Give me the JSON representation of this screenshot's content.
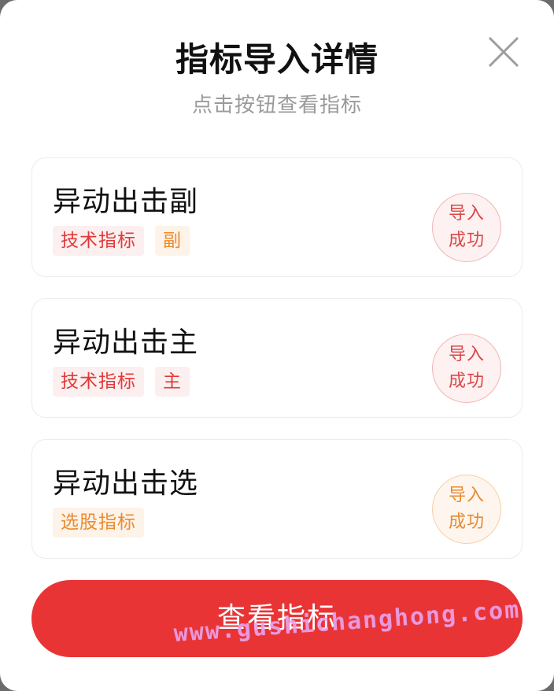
{
  "dialog": {
    "title": "指标导入详情",
    "subtitle": "点击按钮查看指标",
    "close_icon": "close-icon"
  },
  "cards": [
    {
      "name": "异动出击副",
      "tags": [
        {
          "label": "技术指标",
          "color": "red"
        },
        {
          "label": "副",
          "color": "orange"
        }
      ],
      "status": {
        "line1": "导入",
        "line2": "成功",
        "color": "red"
      }
    },
    {
      "name": "异动出击主",
      "tags": [
        {
          "label": "技术指标",
          "color": "red"
        },
        {
          "label": "主",
          "color": "red"
        }
      ],
      "status": {
        "line1": "导入",
        "line2": "成功",
        "color": "red"
      }
    },
    {
      "name": "异动出击选",
      "tags": [
        {
          "label": "选股指标",
          "color": "orange"
        }
      ],
      "status": {
        "line1": "导入",
        "line2": "成功",
        "color": "orange"
      }
    }
  ],
  "primary_button": {
    "label": "查看指标"
  },
  "watermark": "www.gushichanghong.com",
  "colors": {
    "accent": "#e93436",
    "tag_red_text": "#e03a3a",
    "tag_orange_text": "#ec8a2e"
  }
}
